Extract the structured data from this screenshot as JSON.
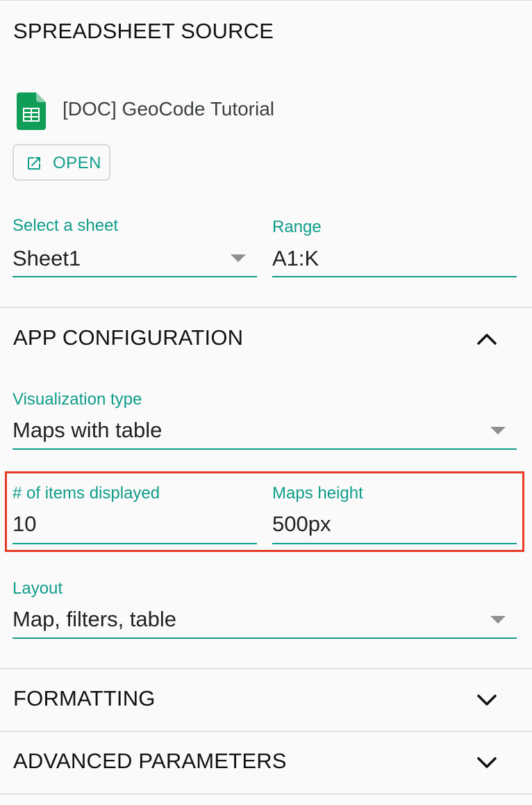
{
  "spreadsheet_source": {
    "title": "SPREADSHEET SOURCE",
    "file_name": "[DOC] GeoCode Tutorial",
    "open_label": "OPEN",
    "sheet_label": "Select a sheet",
    "sheet_value": "Sheet1",
    "range_label": "Range",
    "range_value": "A1:K"
  },
  "app_configuration": {
    "title": "APP CONFIGURATION",
    "visualization_label": "Visualization type",
    "visualization_value": "Maps with table",
    "items_label": "# of items displayed",
    "items_value": "10",
    "maps_height_label": "Maps height",
    "maps_height_value": "500px",
    "layout_label": "Layout",
    "layout_value": "Map, filters, table"
  },
  "formatting": {
    "title": "FORMATTING"
  },
  "advanced_parameters": {
    "title": "ADVANCED PARAMETERS"
  },
  "colors": {
    "accent": "#0f9d8a",
    "highlight": "#e63b27",
    "sheets_green": "#0f9d58"
  },
  "icons": {
    "file": "google-sheets-icon",
    "open": "open-in-new-icon",
    "collapse": "chevron-up-icon",
    "expand": "chevron-down-icon",
    "dropdown": "caret-down-icon"
  }
}
